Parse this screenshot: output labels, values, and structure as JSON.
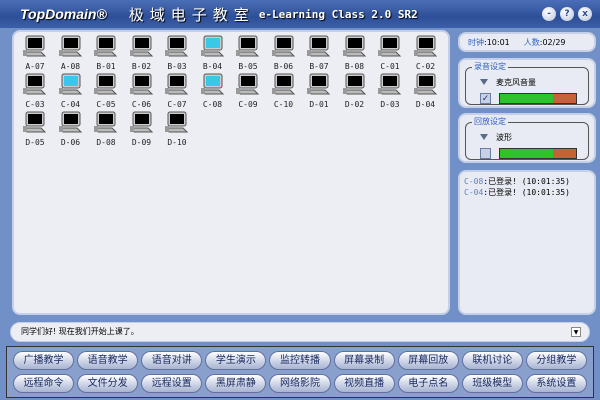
{
  "title": {
    "brand": "TopDomain®",
    "cn": "极域电子教室",
    "en": "e-Learning Class 2.0 SR2"
  },
  "window_buttons": [
    "-",
    "?",
    "x"
  ],
  "computers": [
    {
      "label": "A-07",
      "active": false
    },
    {
      "label": "A-08",
      "active": false
    },
    {
      "label": "B-01",
      "active": false
    },
    {
      "label": "B-02",
      "active": false
    },
    {
      "label": "B-03",
      "active": false
    },
    {
      "label": "B-04",
      "active": true
    },
    {
      "label": "B-05",
      "active": false
    },
    {
      "label": "B-06",
      "active": false
    },
    {
      "label": "B-07",
      "active": false
    },
    {
      "label": "B-08",
      "active": false
    },
    {
      "label": "C-01",
      "active": false
    },
    {
      "label": "C-02",
      "active": false
    },
    {
      "label": "C-03",
      "active": false
    },
    {
      "label": "C-04",
      "active": true
    },
    {
      "label": "C-05",
      "active": false
    },
    {
      "label": "C-06",
      "active": false
    },
    {
      "label": "C-07",
      "active": false
    },
    {
      "label": "C-08",
      "active": true
    },
    {
      "label": "C-09",
      "active": false
    },
    {
      "label": "C-10",
      "active": false
    },
    {
      "label": "D-01",
      "active": false
    },
    {
      "label": "D-02",
      "active": false
    },
    {
      "label": "D-03",
      "active": false
    },
    {
      "label": "D-04",
      "active": false
    },
    {
      "label": "D-05",
      "active": false
    },
    {
      "label": "D-06",
      "active": false
    },
    {
      "label": "D-08",
      "active": false
    },
    {
      "label": "D-09",
      "active": false
    },
    {
      "label": "D-10",
      "active": false
    }
  ],
  "status": {
    "clock_label": "时钟",
    "clock": "10:01",
    "count_label": "人数",
    "count": "02/29"
  },
  "record": {
    "title": "录音设定",
    "source": "麦克风音量",
    "checked": true,
    "level": 0.7
  },
  "playback": {
    "title": "回放设定",
    "source": "波形",
    "checked": false,
    "level": 0.7
  },
  "log": [
    {
      "id": "C-08",
      "text": "已登录! (10:01:35)"
    },
    {
      "id": "C-04",
      "text": "已登录! (10:01:35)"
    }
  ],
  "message": "同学们好! 现在我们开始上课了。",
  "buttons": [
    "广播教学",
    "语音教学",
    "语音对讲",
    "学生演示",
    "监控转播",
    "屏幕录制",
    "屏幕回放",
    "联机讨论",
    "分组教学",
    "远程命令",
    "文件分发",
    "远程设置",
    "黑屏肃静",
    "网络影院",
    "视频直播",
    "电子点名",
    "班级模型",
    "系统设置"
  ]
}
